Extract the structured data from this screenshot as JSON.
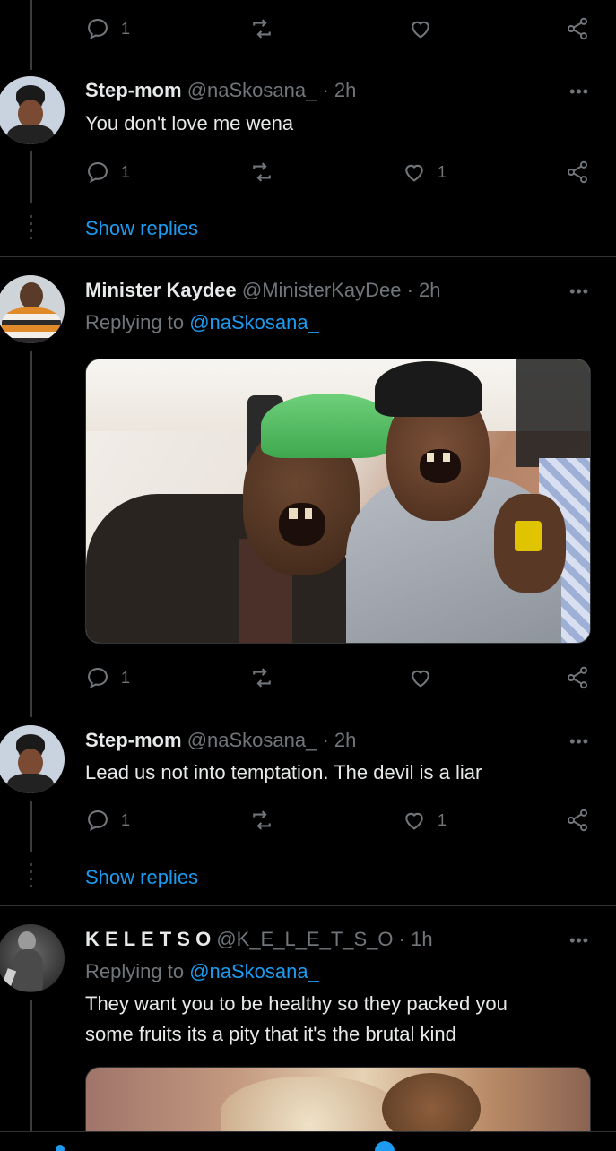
{
  "top_actions": {
    "reply_count": "1"
  },
  "tweets": [
    {
      "name": "Step-mom",
      "handle": "@naSkosana_",
      "time": "· 2h",
      "text": "You don't love me wena",
      "reply_count": "1",
      "like_count": "1",
      "show_replies": "Show replies"
    },
    {
      "name": "Minister Kaydee",
      "handle": "@MinisterKayDee",
      "time": "· 2h",
      "replying_prefix": "Replying to ",
      "replying_to": "@naSkosana_",
      "reply_count": "1"
    },
    {
      "name": "Step-mom",
      "handle": "@naSkosana_",
      "time": "· 2h",
      "text": "Lead us not into temptation. The devil is a liar",
      "reply_count": "1",
      "like_count": "1",
      "show_replies": "Show replies"
    },
    {
      "name": "K E L E T S O",
      "handle": "@K_E_L_E_T_S_O",
      "time": "· 1h",
      "replying_prefix": "Replying to ",
      "replying_to": "@naSkosana_",
      "text_line1": "They want you to be healthy so they packed you",
      "text_line2": "some fruits its a pity that it's the brutal kind"
    }
  ],
  "more_label": "•••",
  "colors": {
    "background": "#000000",
    "text": "#e7e9ea",
    "muted": "#71767b",
    "link": "#1d9bf0",
    "divider": "#2f3336"
  },
  "icons": [
    "reply-icon",
    "retweet-icon",
    "like-icon",
    "share-icon",
    "more-icon"
  ]
}
